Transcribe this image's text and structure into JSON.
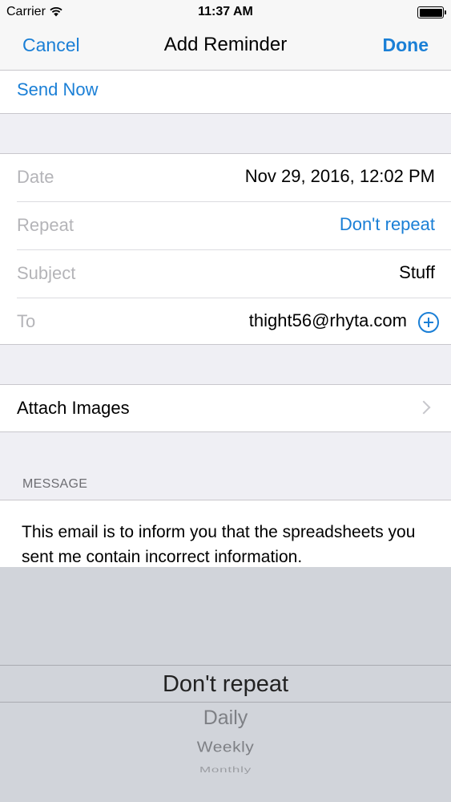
{
  "status_bar": {
    "carrier": "Carrier",
    "time": "11:37 AM"
  },
  "nav": {
    "cancel": "Cancel",
    "title": "Add Reminder",
    "done": "Done"
  },
  "send_now": "Send Now",
  "form": {
    "rows": [
      {
        "label": "Date",
        "value": "Nov 29, 2016, 12:02 PM"
      },
      {
        "label": "Repeat",
        "value": "Don't repeat"
      },
      {
        "label": "Subject",
        "value": "Stuff"
      },
      {
        "label": "To",
        "value": "thight56@rhyta.com"
      }
    ]
  },
  "attach_images": "Attach Images",
  "message": {
    "header": "MESSAGE",
    "body": "This email is to inform you that the spreadsheets you sent me contain incorrect information."
  },
  "picker": {
    "options": [
      "Don't repeat",
      "Daily",
      "Weekly",
      "Monthly"
    ]
  },
  "colors": {
    "accent": "#1a7fd6",
    "background": "#efeff4",
    "picker_bg": "#d1d4da"
  }
}
